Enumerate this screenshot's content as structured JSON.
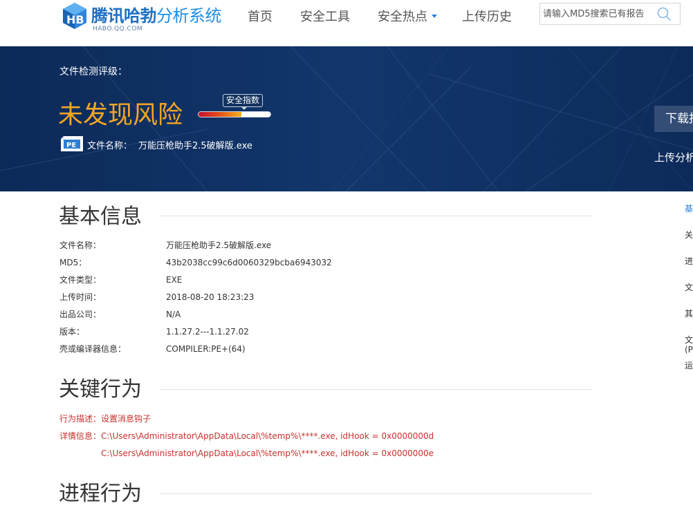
{
  "header": {
    "logo_brand": "腾讯哈勃",
    "logo_rest": "分析系统",
    "logo_sub": "HABO.QQ.COM",
    "nav": [
      {
        "label": "首页"
      },
      {
        "label": "安全工具"
      },
      {
        "label": "安全热点"
      },
      {
        "label": "上传历史"
      }
    ],
    "search_placeholder": "请输入MD5搜索已有报告"
  },
  "banner": {
    "rating_label": "文件检测评级：",
    "verdict": "未发现风险",
    "safety_tag": "安全指数",
    "safety_level": 0.6,
    "file_label": "文件名称：",
    "file_name": "万能压枪助手2.5破解版.exe",
    "download_label": "下载报",
    "upload_label": "上传分析"
  },
  "basic": {
    "title": "基本信息",
    "rows": [
      {
        "label": "文件名称：",
        "value": "万能压枪助手2.5破解版.exe"
      },
      {
        "label": "MD5：",
        "value": "43b2038cc99c6d0060329bcba6943032"
      },
      {
        "label": "文件类型：",
        "value": "EXE"
      },
      {
        "label": "上传时间：",
        "value": "2018-08-20 18:23:23"
      },
      {
        "label": "出品公司：",
        "value": "N/A"
      },
      {
        "label": "版本：",
        "value": "1.1.27.2---1.1.27.02"
      },
      {
        "label": "壳或编译器信息：",
        "value": "COMPILER:PE+(64)"
      }
    ]
  },
  "key_behavior": {
    "title": "关键行为",
    "desc_label": "行为描述：",
    "desc_value": "设置消息钩子",
    "detail_label": "详情信息：",
    "details": [
      "C:\\Users\\Administrator\\AppData\\Local\\%temp%\\****.exe, idHook = 0x0000000d",
      "C:\\Users\\Administrator\\AppData\\Local\\%temp%\\****.exe, idHook = 0x0000000e"
    ]
  },
  "process": {
    "title": "进程行为"
  },
  "side_nav": [
    {
      "label": "基"
    },
    {
      "label": "关"
    },
    {
      "label": "进"
    },
    {
      "label": "文"
    },
    {
      "label": "其"
    },
    {
      "label": "文"
    },
    {
      "label": "(P"
    },
    {
      "label": "运"
    }
  ],
  "colors": {
    "banner_bg": "#0f2f60",
    "verdict": "#f5a623",
    "brand_blue": "#1f6fc2",
    "behavior_red": "#c9302c"
  }
}
